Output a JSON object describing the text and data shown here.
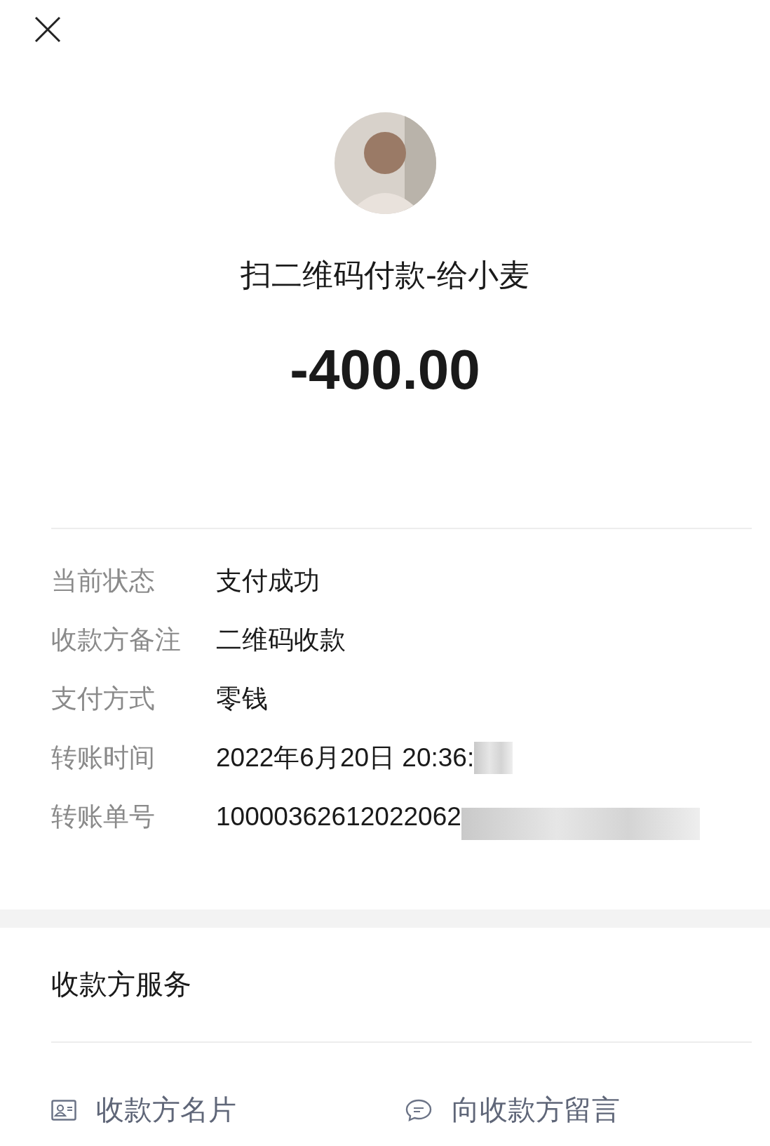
{
  "title": "扫二维码付款-给小麦",
  "amount": "-400.00",
  "details": [
    {
      "label": "当前状态",
      "value": "支付成功",
      "redacted": false
    },
    {
      "label": "收款方备注",
      "value": "二维码收款",
      "redacted": false
    },
    {
      "label": "支付方式",
      "value": "零钱",
      "redacted": false
    },
    {
      "label": "转账时间",
      "value": "2022年6月20日 20:36:",
      "redacted": true
    },
    {
      "label": "转账单号",
      "value": "10000362612022062",
      "redacted": true
    }
  ],
  "services": {
    "heading": "收款方服务",
    "links": [
      {
        "label": "收款方名片",
        "kind": "card"
      },
      {
        "label": "向收款方留言",
        "kind": "message"
      }
    ]
  }
}
